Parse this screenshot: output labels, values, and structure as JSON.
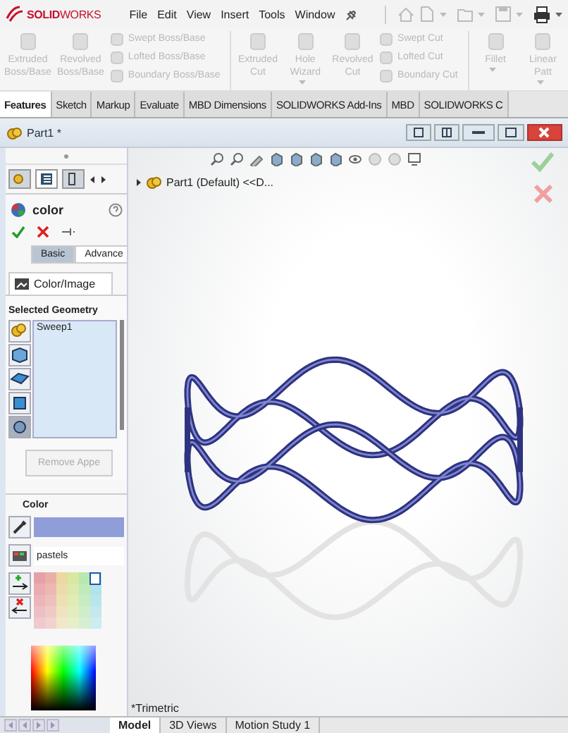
{
  "app": {
    "logo": "**SOLID**WORKS",
    "menu": [
      "File",
      "Edit",
      "View",
      "Insert",
      "Tools",
      "Window"
    ]
  },
  "ribbon": [
    {
      "kind": "large",
      "label": "Extruded Boss/Base",
      "disabled": true,
      "dropdown": false
    },
    {
      "kind": "large",
      "label": "Revolved Boss/Base",
      "disabled": true,
      "dropdown": false
    },
    {
      "kind": "stack",
      "items": [
        {
          "label": "Swept Boss/Base",
          "disabled": true
        },
        {
          "label": "Lofted Boss/Base",
          "disabled": true
        },
        {
          "label": "Boundary Boss/Base",
          "disabled": true
        }
      ]
    },
    {
      "kind": "large",
      "label": "Extruded Cut",
      "disabled": true,
      "dropdown": false
    },
    {
      "kind": "large",
      "label": "Hole Wizard",
      "disabled": true,
      "dropdown": true
    },
    {
      "kind": "large",
      "label": "Revolved Cut",
      "disabled": true,
      "dropdown": false
    },
    {
      "kind": "stack",
      "items": [
        {
          "label": "Swept Cut",
          "disabled": true
        },
        {
          "label": "Lofted Cut",
          "disabled": true
        },
        {
          "label": "Boundary Cut",
          "disabled": true
        }
      ]
    },
    {
      "kind": "large",
      "label": "Fillet",
      "disabled": true,
      "dropdown": true
    },
    {
      "kind": "large",
      "label": "Linear Patt",
      "disabled": true,
      "dropdown": true
    }
  ],
  "tabs": [
    {
      "label": "Features",
      "selected": true
    },
    {
      "label": "Sketch",
      "selected": false
    },
    {
      "label": "Markup",
      "selected": false
    },
    {
      "label": "Evaluate",
      "selected": false
    },
    {
      "label": "MBD Dimensions",
      "selected": false
    },
    {
      "label": "SOLIDWORKS Add-Ins",
      "selected": false
    },
    {
      "label": "MBD",
      "selected": false
    },
    {
      "label": "SOLIDWORKS C",
      "selected": false
    }
  ],
  "document": {
    "title": "Part1 *"
  },
  "property_manager": {
    "title": "color",
    "modes": [
      {
        "label": "Basic",
        "selected": true
      },
      {
        "label": "Advance",
        "selected": false
      }
    ],
    "tab": "Color/Image",
    "selected_geometry": {
      "heading": "Selected Geometry",
      "items": [
        "Sweep1"
      ]
    },
    "remove_button": {
      "label": "Remove Appe",
      "disabled": true
    },
    "color": {
      "heading": "Color",
      "color": "#8f9ed8"
    },
    "palette": {
      "value": "pastels"
    }
  },
  "viewport": {
    "tree_item": "Part1 (Default) <<D...",
    "view_label": "*Trimetric"
  },
  "bottom_tabs": [
    {
      "label": "Model",
      "selected": true
    },
    {
      "label": "3D Views",
      "selected": false
    },
    {
      "label": "Motion Study 1",
      "selected": false
    }
  ]
}
